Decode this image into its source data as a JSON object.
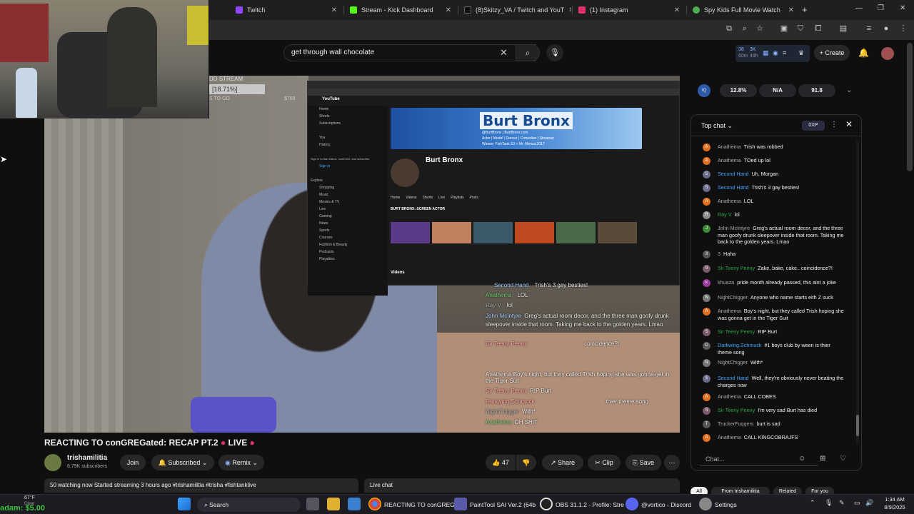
{
  "browser": {
    "tabs": [
      {
        "label": "Twitch",
        "color": "#9146ff"
      },
      {
        "label": "Stream - Kick Dashboard",
        "color": "#53fc18"
      },
      {
        "label": "(8)Skitzy_VA / Twitch and YouT",
        "color": "#000000"
      },
      {
        "label": "(1) Instagram",
        "color": "#e1306c"
      },
      {
        "label": "Spy Kids Full Movie Watch",
        "color": "#4caf50"
      }
    ],
    "new_tab": "+"
  },
  "youtube": {
    "search": {
      "value": "get through wall chocolate"
    },
    "stats": {
      "a": "38",
      "a_sub": "60m",
      "b": "3K",
      "b_sub": "48h"
    },
    "create_label": "Create"
  },
  "video": {
    "overlay": {
      "stream_label": "DD STREAM",
      "goal_pct": "[18.71%]",
      "goal_text": "S TO GO",
      "goal_amount": "$700"
    },
    "share": {
      "site": "YouTube",
      "banner_title": "Burt Bronx",
      "banner_sub": "@BurtBronx | BurtBronx.com",
      "banner_tagline": "Actor | Model | Dancer | Comedian | Streamer",
      "banner_winner": "Winner: FishTank S3 + Mr. Mensa 2017",
      "channel_name": "Burt Bronx",
      "tabs": [
        "Home",
        "Videos",
        "Shorts",
        "Live",
        "Playlists",
        "Posts"
      ],
      "section": "BURT BRONX: SCREEN ACTOR",
      "videos_label": "Videos",
      "sidebar": [
        "Home",
        "Shorts",
        "Subscriptions",
        "",
        "You",
        "History",
        "",
        "Sign in to like videos, comment, and subscribe.",
        "Sign in",
        "",
        "Explore",
        "Shopping",
        "Music",
        "Movies & TV",
        "Live",
        "Gaming",
        "News",
        "Sports",
        "Courses",
        "Fashion & Beauty",
        "Podcasts",
        "Playables"
      ]
    },
    "chat_overlay": [
      {
        "author": "Second Hand",
        "text": "Trish's 3 gay besties!"
      },
      {
        "author": "Anathema",
        "text": "LOL"
      },
      {
        "author": "Ray V",
        "text": "lol"
      },
      {
        "author": "John McIntyre",
        "text": "Greg's actual room decor, and the three man goofy drunk"
      },
      {
        "author": "",
        "text": "sleepover inside that room. Taking me back to the golden years. Lmao"
      },
      {
        "author": "Sir Teeny Peeny",
        "text": "coincidence?!"
      },
      {
        "author": "",
        "text": "Anathema Boy's night, but they called Trish hoping she was gonna get in the Tiger Suit"
      },
      {
        "author": "Sir Teeny Peeny",
        "text": "RIP Burt"
      },
      {
        "author": "Darkwing.Schmuck",
        "text": "thier theme song"
      },
      {
        "author": "NightChigger",
        "text": "With*"
      },
      {
        "author": "Anathema",
        "text": "OH SHIT"
      }
    ],
    "title": "REACTING TO conGREGated: RECAP PT.2",
    "live_badge": "LIVE",
    "channel": {
      "name": "trishamilitia",
      "subs": "6.79K subscribers"
    },
    "join_label": "Join",
    "subscribed_label": "Subscribed",
    "remix_label": "Remix",
    "likes": "47",
    "share_label": "Share",
    "clip_label": "Clip",
    "save_label": "Save",
    "info": "50 watching now  Started streaming 3 hours ago  #trishamilitia #trisha #fishtanklive",
    "livechat_label": "Live chat"
  },
  "iq": {
    "logo": "IQ",
    "stats": [
      "12.8%",
      "N/A",
      "91.8"
    ]
  },
  "chat": {
    "title": "Top chat",
    "xp": "0XP",
    "input_placeholder": "Chat...",
    "messages": [
      {
        "author": "Anathema",
        "text": "Trish was robbed",
        "initial": "A",
        "color": "#e0701f",
        "style": "gray"
      },
      {
        "author": "Anathema",
        "text": "TOed up lol",
        "initial": "A",
        "color": "#e0701f",
        "style": "gray"
      },
      {
        "author": "Second Hand",
        "text": "Uh, Morgan",
        "initial": "S",
        "color": "#6a6a8a",
        "style": "blue"
      },
      {
        "author": "Second Hand",
        "text": "Trish's 3 gay besties!",
        "initial": "S",
        "color": "#6a6a8a",
        "style": "blue"
      },
      {
        "author": "Anathema",
        "text": "LOL",
        "initial": "A",
        "color": "#e0701f",
        "style": "gray"
      },
      {
        "author": "Ray V",
        "text": "lol",
        "initial": "R",
        "color": "#888888",
        "style": "green"
      },
      {
        "author": "John McIntyre",
        "text": "Greg's actual room decor, and the three man goofy drunk sleepover inside that room. Taking me back to the golden years. Lmao",
        "initial": "J",
        "color": "#3a8a3a",
        "style": "gray"
      },
      {
        "author": "3",
        "text": "Haha",
        "initial": "3",
        "color": "#555555",
        "style": "gray"
      },
      {
        "author": "Sir Teeny Peeny",
        "text": "Zake, bake, cake.. coincidence?!",
        "initial": "S",
        "color": "#7a5a6a",
        "style": "green"
      },
      {
        "author": "khuaza",
        "text": "pride month already passed, this aint a joke",
        "initial": "k",
        "color": "#9a3a9a",
        "style": "gray"
      },
      {
        "author": "NightChigger",
        "text": "Anyone who name starts eith Z suck",
        "initial": "N",
        "color": "#777777",
        "style": "gray"
      },
      {
        "author": "Anathema",
        "text": "Boy's night, but they called Trish hoping she was gonna get in the Tiger Suit",
        "initial": "A",
        "color": "#e0701f",
        "style": "gray"
      },
      {
        "author": "Sir Teeny Peeny",
        "text": "RIP Burt",
        "initial": "S",
        "color": "#7a5a6a",
        "style": "green"
      },
      {
        "author": "Darkwing.Schmuck",
        "text": "#1  boys club by ween is thier theme song",
        "initial": "D",
        "color": "#5a5a5a",
        "style": "blue"
      },
      {
        "author": "NightChigger",
        "text": "With*",
        "initial": "N",
        "color": "#777777",
        "style": "gray"
      },
      {
        "author": "Second Hand",
        "text": "Well, they're obviously never beating the charges now",
        "initial": "S",
        "color": "#6a6a8a",
        "style": "blue"
      },
      {
        "author": "Anathema",
        "text": "CALL COBES",
        "initial": "A",
        "color": "#e0701f",
        "style": "gray"
      },
      {
        "author": "Sir Teeny Peeny",
        "text": "I'm very sad Burt has died",
        "initial": "S",
        "color": "#7a5a6a",
        "style": "green"
      },
      {
        "author": "TruckerFuqqers",
        "text": "burt is sad",
        "initial": "T",
        "color": "#555555",
        "style": "gray"
      },
      {
        "author": "Anathema",
        "text": "CALL KINGCOBRAJFS",
        "initial": "A",
        "color": "#e0701f",
        "style": "gray"
      }
    ],
    "chips": [
      "All",
      "From trishamilitia",
      "Related",
      "For you"
    ]
  },
  "taskbar": {
    "weather": "67°F",
    "weather_sub": "Clear",
    "donation": "adam: $5.00",
    "search": "Search",
    "apps": [
      {
        "label": "REACTING TO conGREG"
      },
      {
        "label": "PaintTool SAI Ver.2 (64b"
      },
      {
        "label": "OBS 31.1.2 - Profile: Stre"
      },
      {
        "label": "@vortico - Discord"
      },
      {
        "label": "Settings"
      }
    ],
    "time": "1:34 AM",
    "date": "8/9/2025"
  }
}
